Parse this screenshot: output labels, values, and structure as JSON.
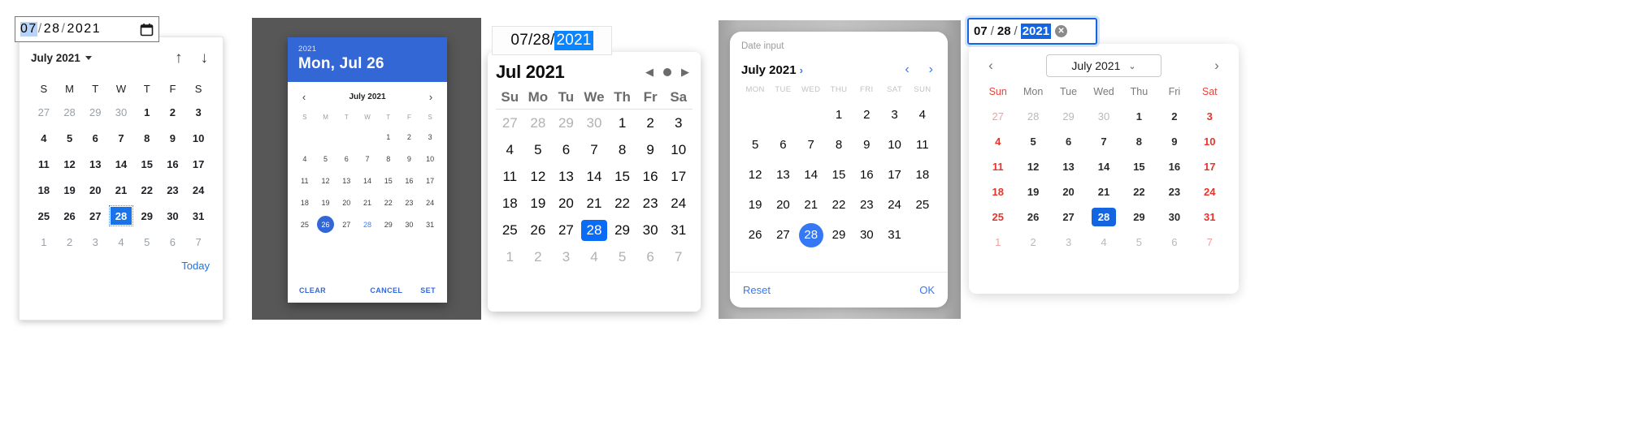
{
  "panel1": {
    "name": "chrome-native-date-picker",
    "input": {
      "month": "07",
      "day": "28",
      "year": "2021",
      "sep": "/",
      "icon": "calendar-icon"
    },
    "header": {
      "month_label": "July 2021",
      "caret": "▾",
      "prev_icon": "↑",
      "next_icon": "↓"
    },
    "dow": [
      "S",
      "M",
      "T",
      "W",
      "T",
      "F",
      "S"
    ],
    "weeks": [
      [
        "27",
        "28",
        "29",
        "30",
        "1",
        "2",
        "3"
      ],
      [
        "4",
        "5",
        "6",
        "7",
        "8",
        "9",
        "10"
      ],
      [
        "11",
        "12",
        "13",
        "14",
        "15",
        "16",
        "17"
      ],
      [
        "18",
        "19",
        "20",
        "21",
        "22",
        "23",
        "24"
      ],
      [
        "25",
        "26",
        "27",
        "28",
        "29",
        "30",
        "31"
      ],
      [
        "1",
        "2",
        "3",
        "4",
        "5",
        "6",
        "7"
      ]
    ],
    "other_cells": [
      "0-0",
      "0-1",
      "0-2",
      "0-3",
      "5-0",
      "5-1",
      "5-2",
      "5-3",
      "5-4",
      "5-5",
      "5-6"
    ],
    "selected_cell": "4-3",
    "footer": {
      "today_label": "Today",
      "accent": "#1a73e8"
    }
  },
  "panel2": {
    "name": "material-date-picker-dialog",
    "header": {
      "year": "2021",
      "date": "Mon, Jul 26",
      "bg": "#3367d6"
    },
    "nav": {
      "prev_icon": "‹",
      "next_icon": "›",
      "month_label": "July 2021"
    },
    "dow": [
      "S",
      "M",
      "T",
      "W",
      "T",
      "F",
      "S"
    ],
    "weeks": [
      [
        "",
        "",
        "",
        "",
        "1",
        "2",
        "3"
      ],
      [
        "4",
        "5",
        "6",
        "7",
        "8",
        "9",
        "10"
      ],
      [
        "11",
        "12",
        "13",
        "14",
        "15",
        "16",
        "17"
      ],
      [
        "18",
        "19",
        "20",
        "21",
        "22",
        "23",
        "24"
      ],
      [
        "25",
        "26",
        "27",
        "28",
        "29",
        "30",
        "31"
      ]
    ],
    "selected_cell": "4-1",
    "today_cell": "4-3",
    "buttons": {
      "clear": "CLEAR",
      "cancel": "CANCEL",
      "set": "SET"
    }
  },
  "panel3": {
    "name": "firefox-date-picker",
    "input": {
      "month": "07",
      "day": "28",
      "year": "2021",
      "sep": "/"
    },
    "header": {
      "month_label": "Jul 2021",
      "prev_icon": "◀",
      "spinner_icon": "●",
      "next_icon": "▶"
    },
    "dow": [
      "Su",
      "Mo",
      "Tu",
      "We",
      "Th",
      "Fr",
      "Sa"
    ],
    "weeks": [
      [
        "27",
        "28",
        "29",
        "30",
        "1",
        "2",
        "3"
      ],
      [
        "4",
        "5",
        "6",
        "7",
        "8",
        "9",
        "10"
      ],
      [
        "11",
        "12",
        "13",
        "14",
        "15",
        "16",
        "17"
      ],
      [
        "18",
        "19",
        "20",
        "21",
        "22",
        "23",
        "24"
      ],
      [
        "25",
        "26",
        "27",
        "28",
        "29",
        "30",
        "31"
      ],
      [
        "1",
        "2",
        "3",
        "4",
        "5",
        "6",
        "7"
      ]
    ],
    "other_cells": [
      "0-0",
      "0-1",
      "0-2",
      "0-3",
      "5-0",
      "5-1",
      "5-2",
      "5-3",
      "5-4",
      "5-5",
      "5-6"
    ],
    "selected_cell": "4-3",
    "accent": "#0a6cf5"
  },
  "panel4": {
    "name": "ios-date-input-sheet",
    "label": "Date input",
    "nav": {
      "month_label": "July 2021",
      "expand_icon": "›",
      "prev_icon": "‹",
      "next_icon": "›"
    },
    "dow": [
      "MON",
      "TUE",
      "WED",
      "THU",
      "FRI",
      "SAT",
      "SUN"
    ],
    "weeks": [
      [
        "",
        "",
        "",
        "1",
        "2",
        "3",
        "4"
      ],
      [
        "5",
        "6",
        "7",
        "8",
        "9",
        "10",
        "11"
      ],
      [
        "12",
        "13",
        "14",
        "15",
        "16",
        "17",
        "18"
      ],
      [
        "19",
        "20",
        "21",
        "22",
        "23",
        "24",
        "25"
      ],
      [
        "26",
        "27",
        "28",
        "29",
        "30",
        "31",
        ""
      ]
    ],
    "selected_cell": "4-2",
    "footer": {
      "reset": "Reset",
      "ok": "OK",
      "accent": "#3478f6"
    }
  },
  "panel5": {
    "name": "wide-date-picker-red-weekends",
    "input": {
      "month": "07",
      "day": "28",
      "year": "2021",
      "sep": "/",
      "clear_icon": "✕"
    },
    "nav": {
      "prev_icon": "‹",
      "month_label": "July 2021",
      "chevron_icon": "⌄",
      "next_icon": "›"
    },
    "dow": [
      "Sun",
      "Mon",
      "Tue",
      "Wed",
      "Thu",
      "Fri",
      "Sat"
    ],
    "weekend_cols": [
      0,
      6
    ],
    "weeks": [
      [
        "27",
        "28",
        "29",
        "30",
        "1",
        "2",
        "3"
      ],
      [
        "4",
        "5",
        "6",
        "7",
        "8",
        "9",
        "10"
      ],
      [
        "11",
        "12",
        "13",
        "14",
        "15",
        "16",
        "17"
      ],
      [
        "18",
        "19",
        "20",
        "21",
        "22",
        "23",
        "24"
      ],
      [
        "25",
        "26",
        "27",
        "28",
        "29",
        "30",
        "31"
      ],
      [
        "1",
        "2",
        "3",
        "4",
        "5",
        "6",
        "7"
      ]
    ],
    "other_cells": [
      "0-0",
      "0-1",
      "0-2",
      "0-3",
      "5-0",
      "5-1",
      "5-2",
      "5-3",
      "5-4",
      "5-5",
      "5-6"
    ],
    "selected_cell": "4-3",
    "accent": "#1565e0",
    "weekend_color": "#e8342a"
  }
}
